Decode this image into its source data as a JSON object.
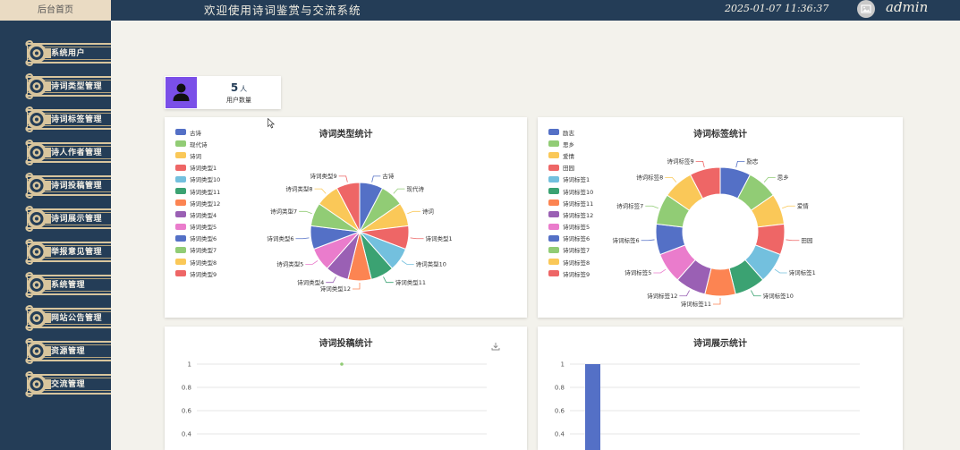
{
  "header": {
    "home_tab": "后台首页",
    "title": "欢迎使用诗词鉴赏与交流系统",
    "datetime": "2025-01-07 11:36:37",
    "username": "admin"
  },
  "sidebar": {
    "items": [
      {
        "label": "系统用户"
      },
      {
        "label": "诗词类型管理"
      },
      {
        "label": "诗词标签管理"
      },
      {
        "label": "诗人作者管理"
      },
      {
        "label": "诗词投稿管理"
      },
      {
        "label": "诗词展示管理"
      },
      {
        "label": "举报意见管理"
      },
      {
        "label": "系统管理"
      },
      {
        "label": "网站公告管理"
      },
      {
        "label": "资源管理"
      },
      {
        "label": "交流管理"
      }
    ]
  },
  "stat": {
    "value": "5",
    "unit": "人",
    "label": "用户数量"
  },
  "colors": {
    "sidebar": "#243d57",
    "accent": "#7a4fe8",
    "palette": [
      "#5470c6",
      "#91cc75",
      "#fac858",
      "#ee6666",
      "#73c0de",
      "#3ba272",
      "#fc8452",
      "#9a60b4",
      "#ea7ccc"
    ]
  },
  "chart_data": [
    {
      "type": "pie",
      "title": "诗词类型统计",
      "categories": [
        "古诗",
        "现代诗",
        "诗词",
        "诗词类型1",
        "诗词类型10",
        "诗词类型11",
        "诗词类型12",
        "诗词类型4",
        "诗词类型5",
        "诗词类型6",
        "诗词类型7",
        "诗词类型8",
        "诗词类型9"
      ],
      "values": [
        1,
        1,
        1,
        1,
        1,
        1,
        1,
        1,
        1,
        1,
        1,
        1,
        1
      ],
      "legend": "top-left"
    },
    {
      "type": "pie",
      "variant": "donut",
      "title": "诗词标签统计",
      "categories": [
        "励志",
        "思乡",
        "爱情",
        "田园",
        "诗词标签1",
        "诗词标签10",
        "诗词标签11",
        "诗词标签12",
        "诗词标签5",
        "诗词标签6",
        "诗词标签7",
        "诗词标签8",
        "诗词标签9"
      ],
      "values": [
        1,
        1,
        1,
        1,
        1,
        1,
        1,
        1,
        1,
        1,
        1,
        1,
        1
      ],
      "legend": "top-left"
    },
    {
      "type": "line",
      "title": "诗词投稿统计",
      "y_ticks": [
        "1",
        "0.8",
        "0.6",
        "0.4"
      ],
      "series": [
        {
          "values": [
            1
          ]
        }
      ],
      "grid": true
    },
    {
      "type": "bar",
      "title": "诗词展示统计",
      "y_ticks": [
        "1",
        "0.8",
        "0.6",
        "0.4"
      ],
      "series": [
        {
          "values": [
            1
          ]
        }
      ],
      "grid": true
    }
  ]
}
